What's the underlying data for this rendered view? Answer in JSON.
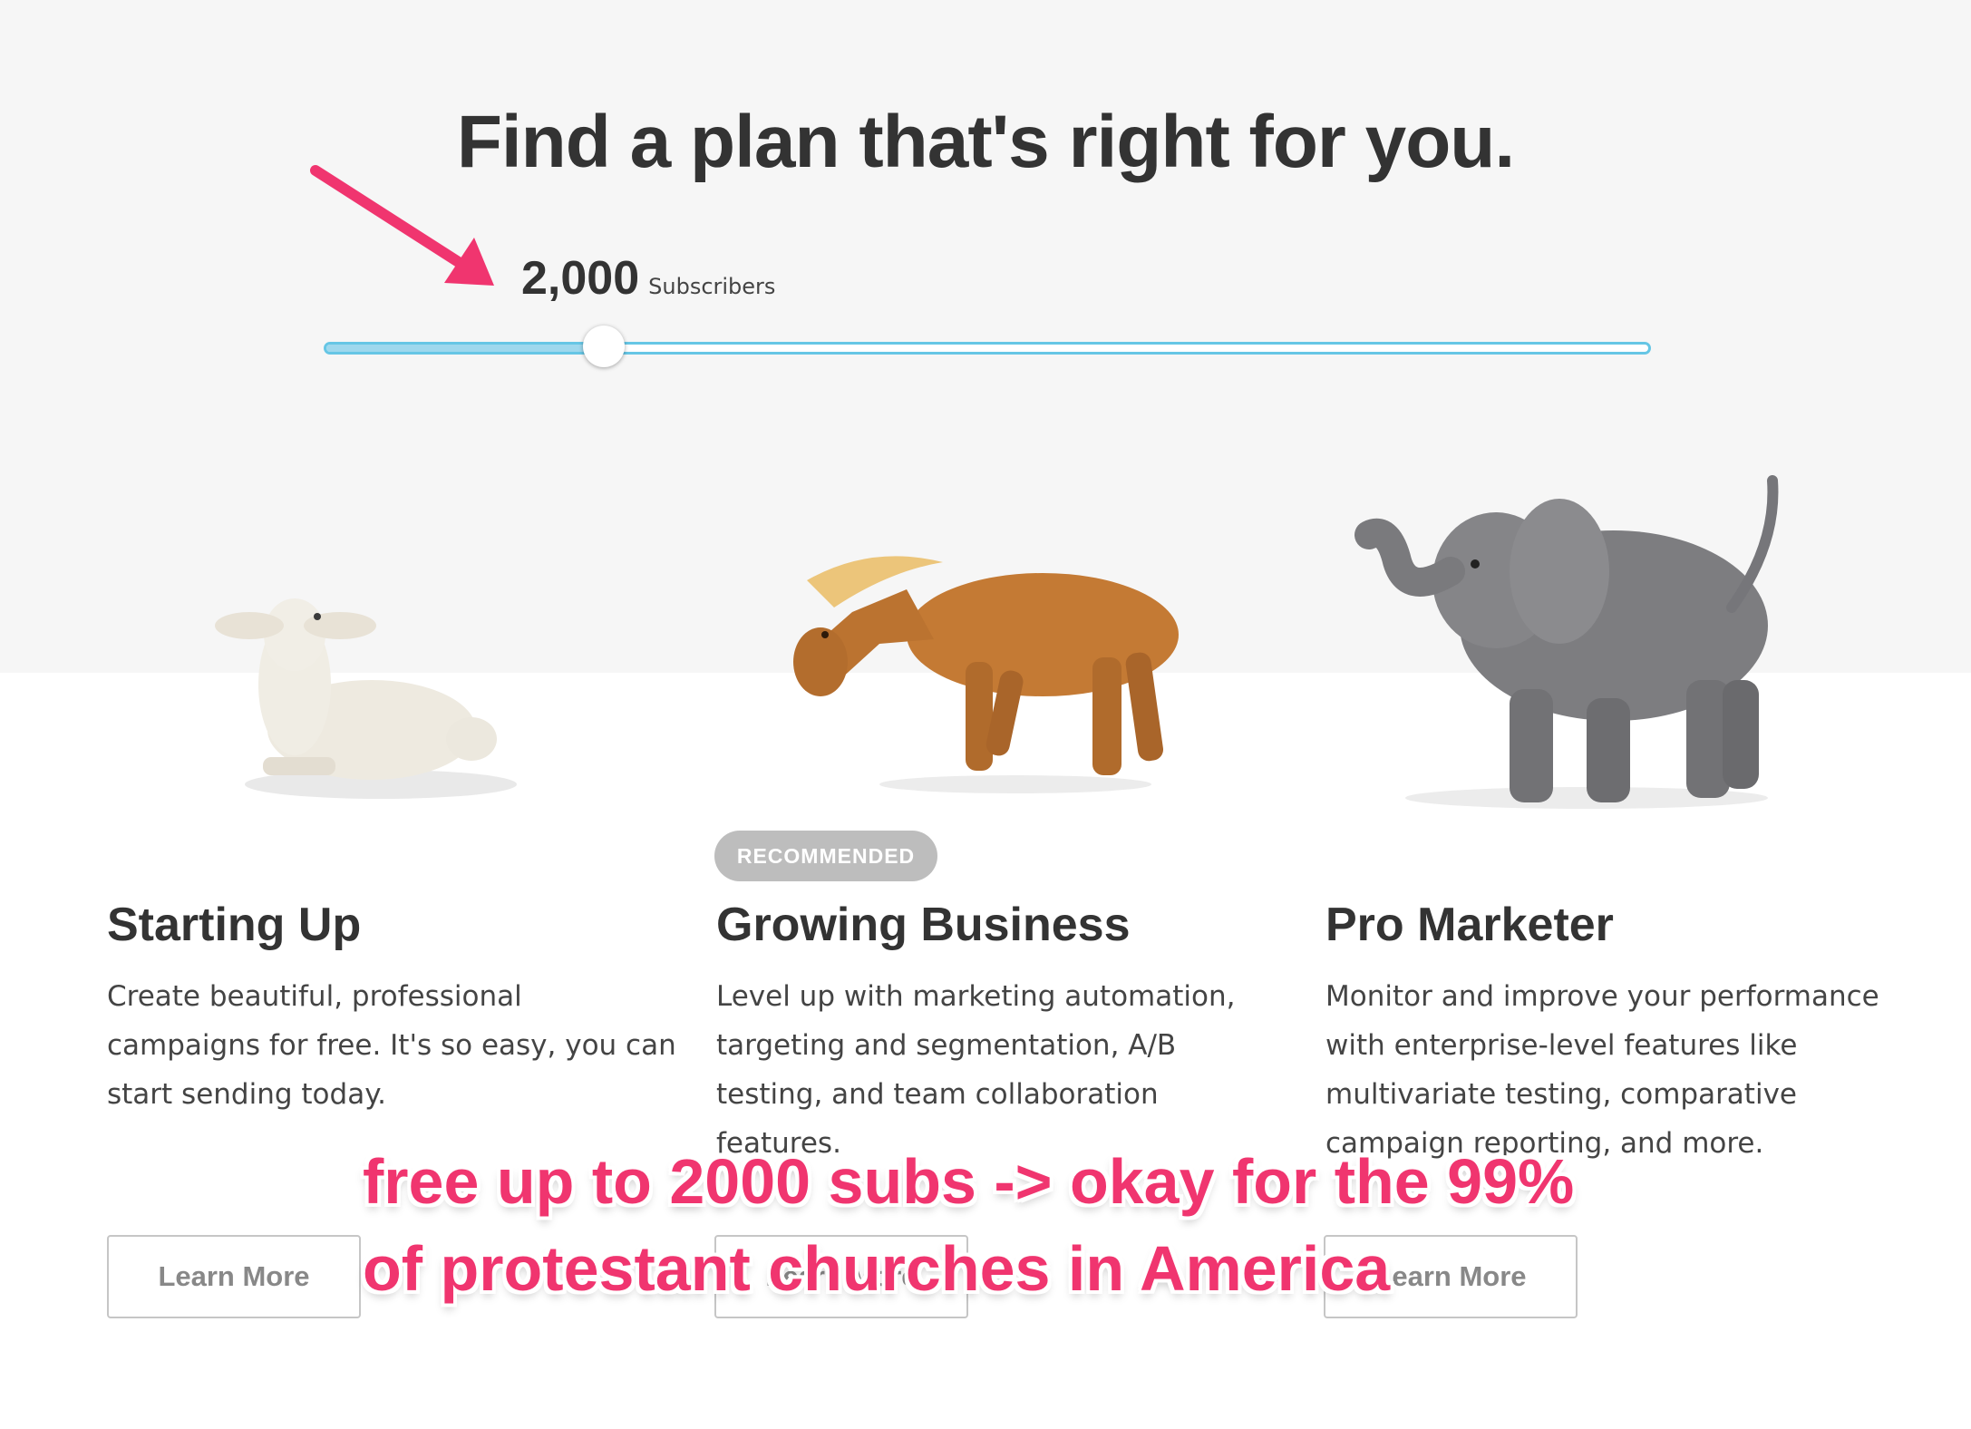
{
  "header": {
    "title": "Find a plan that's right for you."
  },
  "subscribers": {
    "count": "2,000",
    "label": "Subscribers",
    "slider_fraction": 0.21
  },
  "plans": [
    {
      "title": "Starting Up",
      "description": "Create beautiful, professional campaigns for free. It's so easy, you can start sending today.",
      "button": "Learn More",
      "image_icon": "lamb-figurine"
    },
    {
      "badge": "RECOMMENDED",
      "title": "Growing Business",
      "description": "Level up with marketing automation, targeting and segmentation, A/B testing, and team collaboration features.",
      "button": "Learn More",
      "image_icon": "horse-figurine"
    },
    {
      "title": "Pro Marketer",
      "description": "Monitor and improve your performance with enterprise-level features like multivariate testing, comparative campaign reporting, and more.",
      "button": "Learn More",
      "image_icon": "elephant-figurine"
    }
  ],
  "annotation": {
    "line1": "free up to 2000 subs -> okay for the 99%",
    "line2": "of protestant churches in America",
    "color": "#f0356f"
  },
  "colors": {
    "slider_track": "#66c6e5",
    "slider_fill": "#9ed8ed",
    "badge_bg": "#bdbdbd",
    "hero_bg": "#f6f6f6"
  }
}
